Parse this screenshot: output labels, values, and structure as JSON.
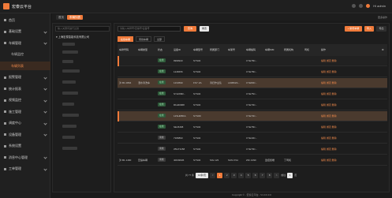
{
  "app": {
    "title": "宏泰云平台",
    "top_right_user": "Hi admin",
    "top_right_sub": "系统管理"
  },
  "sidebar": {
    "items": [
      {
        "label": "首页",
        "sub": false,
        "active": false,
        "chev": false
      },
      {
        "label": "基础设置",
        "sub": false,
        "active": false,
        "chev": true
      },
      {
        "label": "车辆管理",
        "sub": false,
        "active": false,
        "chev": true
      },
      {
        "label": "车辆监控",
        "sub": true,
        "active": false,
        "chev": false
      },
      {
        "label": "车辆列表",
        "sub": true,
        "active": true,
        "chev": false
      },
      {
        "label": "报警管理",
        "sub": false,
        "active": false,
        "chev": true
      },
      {
        "label": "统计报表",
        "sub": false,
        "active": false,
        "chev": true
      },
      {
        "label": "视频监控",
        "sub": false,
        "active": false,
        "chev": true
      },
      {
        "label": "施工管理",
        "sub": false,
        "active": false,
        "chev": true
      },
      {
        "label": "调度中心",
        "sub": false,
        "active": false,
        "chev": true
      },
      {
        "label": "设备管理",
        "sub": false,
        "active": false,
        "chev": true
      },
      {
        "label": "系统设置",
        "sub": false,
        "active": false,
        "chev": false
      },
      {
        "label": "消息中心管理",
        "sub": false,
        "active": false,
        "chev": true
      },
      {
        "label": "工单管理",
        "sub": false,
        "active": false,
        "chev": true
      }
    ]
  },
  "tabs": [
    {
      "label": "首页",
      "active": false
    },
    {
      "label": "车辆列表",
      "active": true
    }
  ],
  "tab_tools": "更多操作",
  "tree": {
    "search_placeholder": "输入关键词进行过滤",
    "root": "上海宏泰智能科技有限公司"
  },
  "toolbar": {
    "search_placeholder": "请输入车牌号/自编号/设备号",
    "query_label": "查询",
    "reset_label": "重置",
    "add_label": "+ 新增车辆",
    "import_label": "导入",
    "export_label": "导出"
  },
  "subtabs": [
    {
      "label": "在线车辆",
      "active": true
    },
    {
      "label": "离线车辆",
      "active": false
    },
    {
      "label": "全部",
      "active": false
    }
  ],
  "table": {
    "headers": [
      "车牌号码",
      "车辆类型",
      "状态",
      "设备ID",
      "车辆型号",
      "所属部门",
      "车架号",
      "车辆编码",
      "车辆SIM",
      "所属机构",
      "司机",
      "操作"
    ],
    "op_labels": "编辑  绑定  删除",
    "rows": [
      {
        "c": [
          "",
          "",
          "在线",
          "9999943",
          "SYS04",
          "",
          "",
          "CYE78C...",
          "",
          "",
          ""
        ],
        "status": "green",
        "style": "alt",
        "mark": true
      },
      {
        "c": [
          "",
          "",
          "在线",
          "1248456",
          "SYS04",
          "",
          "",
          "CYE78C...",
          "",
          "",
          ""
        ],
        "status": "green",
        "style": "",
        "mark": false
      },
      {
        "c": [
          "沪·B1·0894",
          "洒水清洗车",
          "在线",
          "1234590",
          "FSY·ZA",
          "清扫作业队",
          "LZ2B6ZA...",
          "CYE80C...",
          "",
          "",
          ""
        ],
        "status": "green",
        "style": "hl",
        "mark": false
      },
      {
        "c": [
          "",
          "",
          "在线",
          "SYsh89R...",
          "SYS04",
          "",
          "",
          "CYE75C...",
          "",
          "",
          ""
        ],
        "status": "green",
        "style": "",
        "mark": false
      },
      {
        "c": [
          "",
          "",
          "在线",
          "Rbd40968",
          "SYS04",
          "",
          "",
          "CYE79C...",
          "",
          "",
          ""
        ],
        "status": "green",
        "style": "",
        "mark": false
      },
      {
        "c": [
          "",
          "",
          "在线",
          "12SHM8KA",
          "SYS0D",
          "",
          "",
          "CYE70C...",
          "",
          "",
          ""
        ],
        "status": "green",
        "style": "hl",
        "mark": true
      },
      {
        "c": [
          "",
          "",
          "在线",
          "SEn5468",
          "SYS04",
          "",
          "",
          "CYE78C...",
          "",
          "",
          ""
        ],
        "status": "green",
        "style": "",
        "mark": false
      },
      {
        "c": [
          "",
          "",
          "离线",
          "7189893",
          "SYS04",
          "",
          "",
          "CYE40C...",
          "",
          "",
          ""
        ],
        "status": "gray",
        "style": "",
        "mark": false
      },
      {
        "c": [
          "",
          "",
          "离线",
          "zBGT1158",
          "SYS04",
          "",
          "",
          "CYE79C...",
          "",
          "",
          ""
        ],
        "status": "gray",
        "style": "",
        "mark": false
      },
      {
        "c": [
          "沪·B1·1490",
          "压缩车辆",
          "离线",
          "40049936",
          "SYS04",
          "SIG·123",
          "SUN·KS1",
          "ZDr·1090",
          "监控终端",
          "丁司机",
          ""
        ],
        "status": "gray",
        "style": "",
        "mark": false
      }
    ]
  },
  "pager": {
    "total": "共 77 条",
    "size": "10条/页",
    "pages": [
      "<",
      "1",
      "2",
      "3",
      "4",
      "5",
      "6",
      "7",
      "8",
      ">"
    ],
    "active": "1",
    "goto": "前往",
    "goto_val": "1",
    "page_unit": "页"
  },
  "footer": "Copyright © - 宏泰云平台 - V1.0.0.3.0"
}
